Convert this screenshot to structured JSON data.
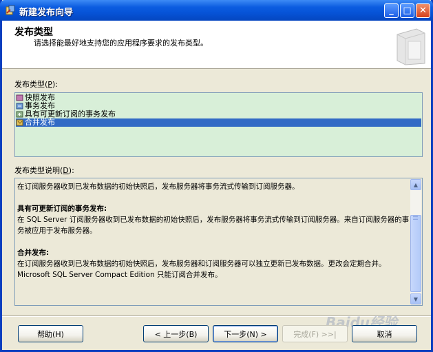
{
  "window": {
    "title": "新建发布向导",
    "buttons": {
      "minimize": "_",
      "maximize": "□",
      "close": "✕"
    }
  },
  "header": {
    "title": "发布类型",
    "subtitle": "请选择能最好地支持您的应用程序要求的发布类型。"
  },
  "publication_types": {
    "label_prefix": "发布类型",
    "label_key": "P",
    "label_suffix": "):",
    "items": [
      {
        "label": "快照发布",
        "icon": "snapshot-icon",
        "selected": false
      },
      {
        "label": "事务发布",
        "icon": "transaction-icon",
        "selected": false
      },
      {
        "label": "具有可更新订阅的事务发布",
        "icon": "updatable-icon",
        "selected": false
      },
      {
        "label": "合并发布",
        "icon": "merge-icon",
        "selected": true
      }
    ]
  },
  "description": {
    "label_prefix": "发布类型说明",
    "label_key": "D",
    "label_suffix": "):",
    "line1": "在订阅服务器收到已发布数据的初始快照后，发布服务器将事务流式传输到订阅服务器。",
    "heading2": "具有可更新订阅的事务发布:",
    "para2": "在 SQL Server 订阅服务器收到已发布数据的初始快照后，发布服务器将事务流式传输到订阅服务器。来自订阅服务器的事务被应用于发布服务器。",
    "heading3": "合并发布:",
    "para3": "在订阅服务器收到已发布数据的初始快照后，发布服务器和订阅服务器可以独立更新已发布数据。更改会定期合并。Microsoft SQL Server Compact Edition 只能订阅合并发布。"
  },
  "buttons": {
    "help": "帮助(H)",
    "back": "< 上一步(B)",
    "next": "下一步(N) >",
    "finish": "完成(F) >>|",
    "cancel": "取消"
  },
  "watermark": "Baidu经验"
}
